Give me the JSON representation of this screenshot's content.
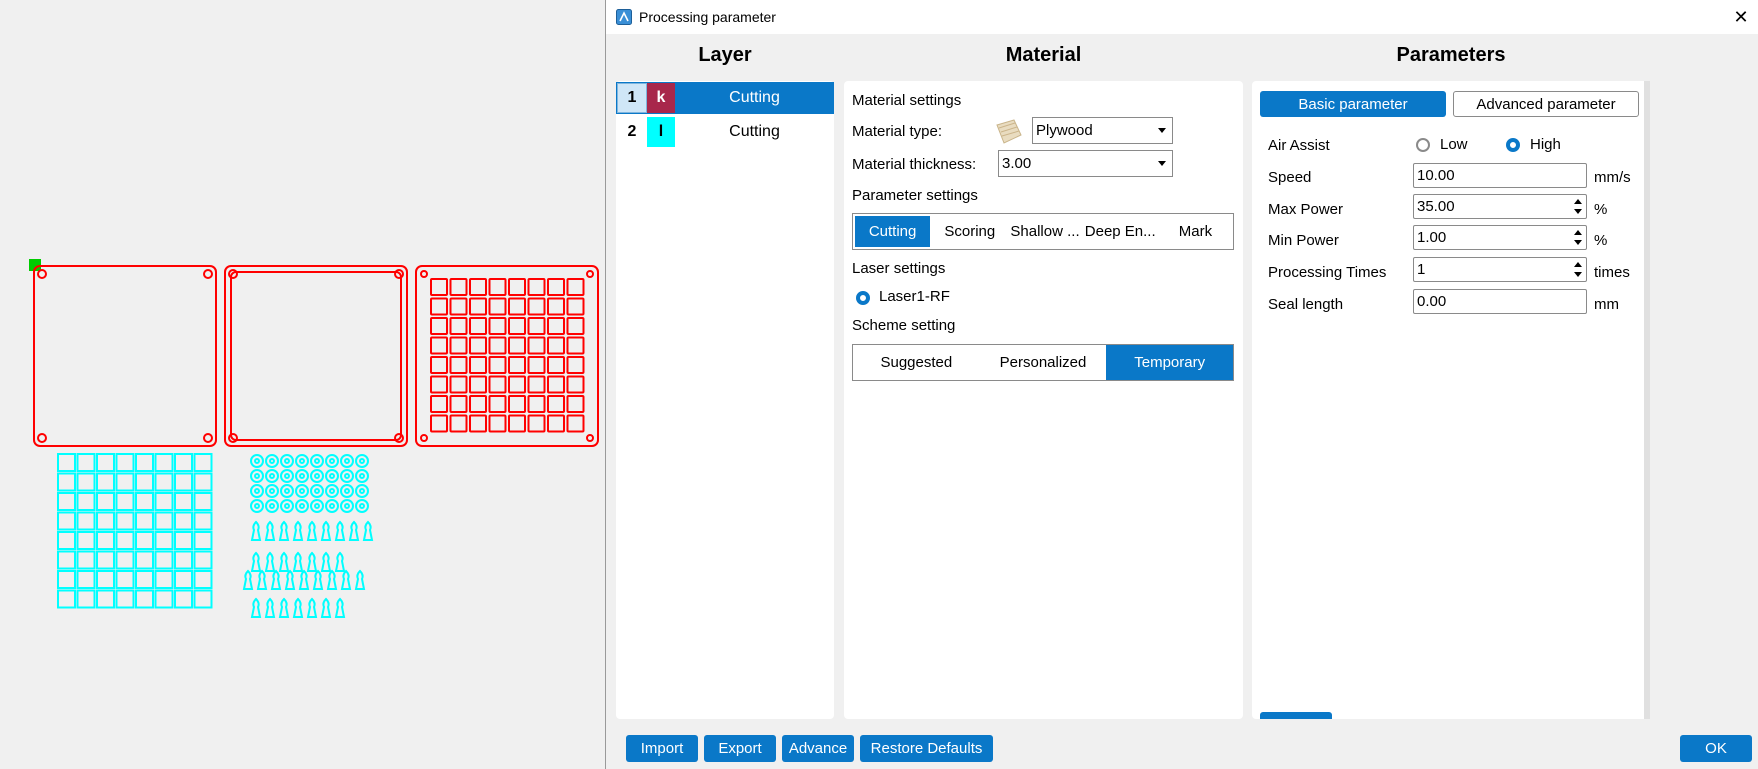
{
  "window": {
    "title": "Processing parameter",
    "close_glyph": "✕"
  },
  "headers": {
    "layer": "Layer",
    "material": "Material",
    "parameters": "Parameters"
  },
  "layers": [
    {
      "num": "1",
      "tag": "k",
      "name": "Cutting",
      "color": "#a8274b",
      "tag_color": "#ffffff",
      "selected": true
    },
    {
      "num": "2",
      "tag": "l",
      "name": "Cutting",
      "color": "#00ffff",
      "tag_color": "#000000",
      "selected": false
    }
  ],
  "material": {
    "section_material": "Material settings",
    "type_label": "Material type:",
    "type_value": "Plywood",
    "thickness_label": "Material thickness:",
    "thickness_value": "3.00",
    "section_params": "Parameter settings",
    "param_tabs": [
      "Cutting",
      "Scoring",
      "Shallow ...",
      "Deep En...",
      "Mark"
    ],
    "section_laser": "Laser settings",
    "laser_option": "Laser1-RF",
    "section_scheme": "Scheme setting",
    "scheme_tabs": [
      "Suggested",
      "Personalized",
      "Temporary"
    ]
  },
  "parameters": {
    "tab_basic": "Basic parameter",
    "tab_advanced": "Advanced parameter",
    "air_assist_label": "Air Assist",
    "air_low": "Low",
    "air_high": "High",
    "speed_label": "Speed",
    "speed_value": "10.00",
    "speed_unit": "mm/s",
    "max_power_label": "Max Power",
    "max_power_value": "35.00",
    "max_power_unit": "%",
    "min_power_label": "Min Power",
    "min_power_value": "1.00",
    "min_power_unit": "%",
    "times_label": "Processing Times",
    "times_value": "1",
    "times_unit": "times",
    "seal_label": "Seal length",
    "seal_value": "0.00",
    "seal_unit": "mm"
  },
  "footer": {
    "import": "Import",
    "export": "Export",
    "advance": "Advance",
    "restore": "Restore Defaults",
    "ok": "OK"
  },
  "colors": {
    "accent": "#0a78c8",
    "cut_red": "#ff0000",
    "cut_cyan": "#00ffff",
    "handle": "#00cc00"
  }
}
